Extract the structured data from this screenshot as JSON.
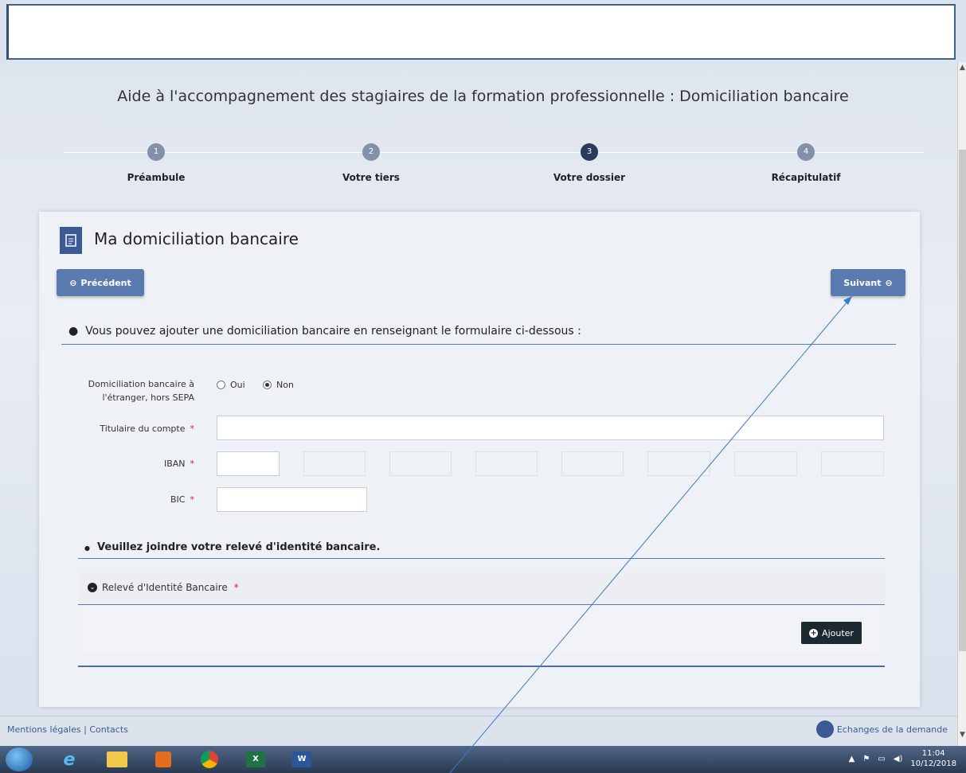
{
  "page": {
    "title": "Aide à l'accompagnement des stagiaires de la formation professionnelle : Domiciliation bancaire"
  },
  "steps": [
    {
      "number": "1",
      "label": "Préambule"
    },
    {
      "number": "2",
      "label": "Votre tiers"
    },
    {
      "number": "3",
      "label": "Votre dossier"
    },
    {
      "number": "4",
      "label": "Récapitulatif"
    }
  ],
  "active_step": "3",
  "card": {
    "title": "Ma domiciliation bancaire",
    "icon": "document-icon"
  },
  "nav": {
    "prev_label": "Précédent",
    "next_label": "Suivant"
  },
  "form": {
    "intro": "Vous pouvez ajouter une domiciliation bancaire en renseignant le formulaire ci-dessous :",
    "foreign_label_line1": "Domiciliation bancaire à",
    "foreign_label_line2": "l'étranger, hors SEPA",
    "option_yes": "Oui",
    "option_no": "Non",
    "selected_option": "Non",
    "holder_label": "Titulaire du compte",
    "holder_value": "",
    "iban_label": "IBAN",
    "iban_segments": [
      "",
      "",
      "",
      "",
      "",
      "",
      "",
      ""
    ],
    "bic_label": "BIC",
    "bic_value": "",
    "required_mark": "*"
  },
  "attachment": {
    "intro": "Veuillez joindre votre relevé d'identité bancaire.",
    "section_label": "Relevé d'Identité Bancaire",
    "add_label": "Ajouter"
  },
  "footer": {
    "links": "Mentions légales | Contacts",
    "exchanges": "Echanges de la demande"
  },
  "taskbar": {
    "time": "11:04",
    "date": "10/12/2018",
    "apps": [
      "internet-explorer-icon",
      "file-explorer-icon",
      "media-player-icon",
      "chrome-icon",
      "excel-icon",
      "word-icon"
    ]
  },
  "colors": {
    "brand": "#3b5a93",
    "nav_button": "#5a7bb0",
    "required": "#d9222a",
    "active_step": "#2a3b5e"
  }
}
